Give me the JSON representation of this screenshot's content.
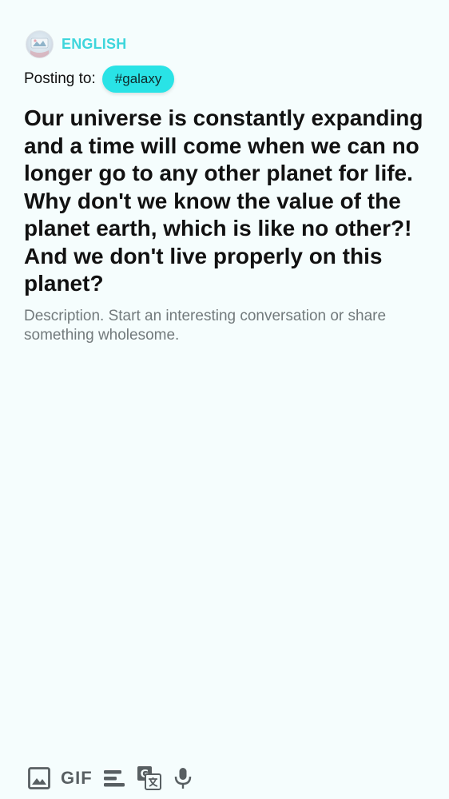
{
  "header": {
    "language": "ENGLISH"
  },
  "posting": {
    "label": "Posting to:",
    "tag": "#galaxy"
  },
  "post": {
    "title": "Our universe is constantly expanding and a time will come when we can no longer go to any other planet for life. Why don't we know the value of the planet earth, which is like no other?! And we don't live properly on this planet?",
    "description_placeholder": "Description. Start an interesting conversation or share something wholesome."
  },
  "toolbar": {
    "gif_label": "GIF",
    "icons": [
      "image-icon",
      "gif-icon",
      "text-format-icon",
      "translate-icon",
      "microphone-icon"
    ]
  },
  "colors": {
    "background": "#f5fdfd",
    "accent": "#3ed6dc",
    "chip": "#29e3e6",
    "icon": "#585f62"
  }
}
